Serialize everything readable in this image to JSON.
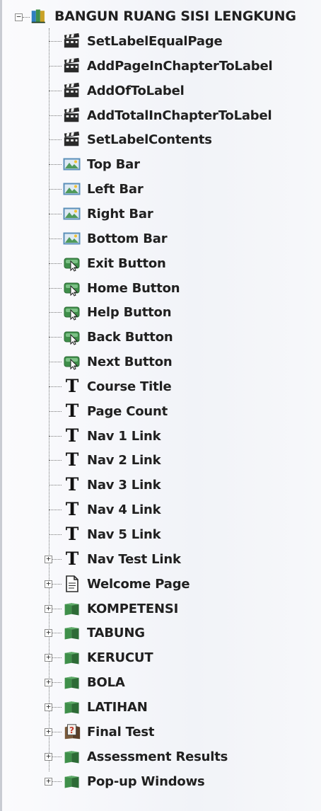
{
  "tree": {
    "root": {
      "label": "BANGUN RUANG SISI LENGKUNG",
      "expander": "−",
      "icon": "book-stack-icon"
    },
    "children": [
      {
        "label": "SetLabelEqualPage",
        "icon": "clapperboard-icon",
        "expandable": false
      },
      {
        "label": "AddPageInChapterToLabel",
        "icon": "clapperboard-icon",
        "expandable": false
      },
      {
        "label": "AddOfToLabel",
        "icon": "clapperboard-icon",
        "expandable": false
      },
      {
        "label": "AddTotalInChapterToLabel",
        "icon": "clapperboard-icon",
        "expandable": false
      },
      {
        "label": "SetLabelContents",
        "icon": "clapperboard-icon",
        "expandable": false
      },
      {
        "label": "Top Bar",
        "icon": "image-icon",
        "expandable": false
      },
      {
        "label": "Left Bar",
        "icon": "image-icon",
        "expandable": false
      },
      {
        "label": "Right Bar",
        "icon": "image-icon",
        "expandable": false
      },
      {
        "label": "Bottom Bar",
        "icon": "image-icon",
        "expandable": false
      },
      {
        "label": "Exit Button",
        "icon": "button-cursor-icon",
        "expandable": false
      },
      {
        "label": "Home Button",
        "icon": "button-cursor-icon",
        "expandable": false
      },
      {
        "label": "Help Button",
        "icon": "button-cursor-icon",
        "expandable": false
      },
      {
        "label": "Back Button",
        "icon": "button-cursor-icon",
        "expandable": false
      },
      {
        "label": "Next Button",
        "icon": "button-cursor-icon",
        "expandable": false
      },
      {
        "label": "Course Title",
        "icon": "text-t-icon",
        "expandable": false
      },
      {
        "label": "Page Count",
        "icon": "text-t-icon",
        "expandable": false
      },
      {
        "label": "Nav 1 Link",
        "icon": "text-t-icon",
        "expandable": false
      },
      {
        "label": "Nav 2 Link",
        "icon": "text-t-icon",
        "expandable": false
      },
      {
        "label": "Nav 3 Link",
        "icon": "text-t-icon",
        "expandable": false
      },
      {
        "label": "Nav 4 Link",
        "icon": "text-t-icon",
        "expandable": false
      },
      {
        "label": "Nav 5 Link",
        "icon": "text-t-icon",
        "expandable": false
      },
      {
        "label": "Nav Test Link",
        "icon": "text-t-icon",
        "expandable": true
      },
      {
        "label": "Welcome Page",
        "icon": "page-icon",
        "expandable": true
      },
      {
        "label": "KOMPETENSI",
        "icon": "chapter-book-icon",
        "expandable": true
      },
      {
        "label": "TABUNG",
        "icon": "chapter-book-icon",
        "expandable": true
      },
      {
        "label": "KERUCUT",
        "icon": "chapter-book-icon",
        "expandable": true
      },
      {
        "label": "BOLA",
        "icon": "chapter-book-icon",
        "expandable": true
      },
      {
        "label": "LATIHAN",
        "icon": "chapter-book-icon",
        "expandable": true
      },
      {
        "label": "Final Test",
        "icon": "test-question-icon",
        "expandable": true
      },
      {
        "label": "Assessment Results",
        "icon": "chapter-book-icon",
        "expandable": true
      },
      {
        "label": "Pop-up Windows",
        "icon": "chapter-book-icon",
        "expandable": true
      }
    ],
    "expander_collapsed": "+"
  },
  "colors": {
    "book_green": "#3f8f4a",
    "book_dark": "#2d6b36",
    "image_frame": "#5b8fb9",
    "clapper_dark": "#2a2a2a"
  }
}
